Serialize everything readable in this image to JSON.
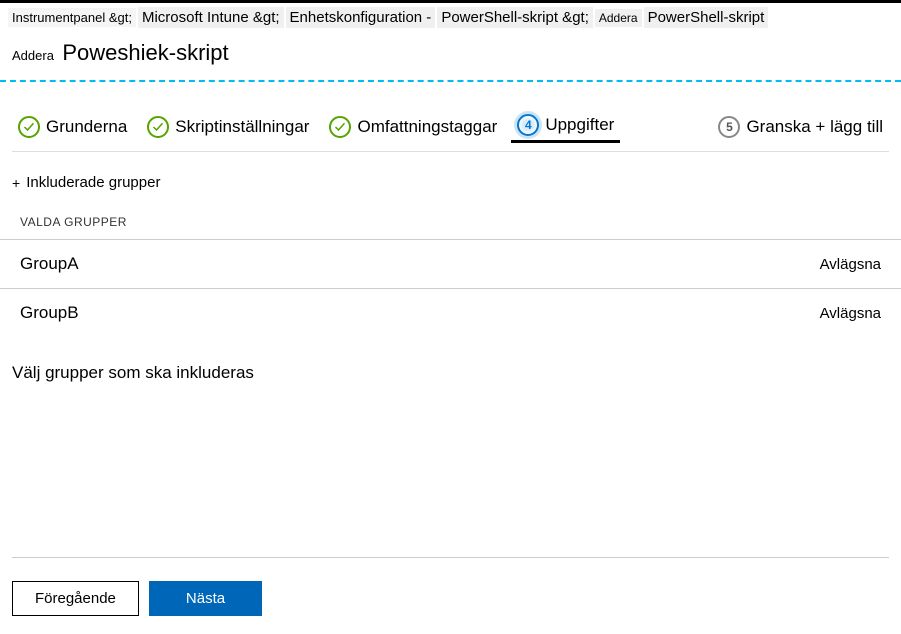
{
  "breadcrumb": {
    "item1": "Instrumentpanel &gt;",
    "item2": "Microsoft Intune &gt;",
    "item3": "Enhetskonfiguration -",
    "item4": "PowerShell-skript &gt;",
    "item5_prefix": "Addera",
    "item5_rest": "PowerShell-skript"
  },
  "header": {
    "addera": "Addera",
    "title": "Poweshiek-skript"
  },
  "steps": {
    "s1": "Grunderna",
    "s2": "Skriptinställningar",
    "s3": "Omfattningstaggar",
    "active_num": "4",
    "s4": "Uppgifter",
    "s5_num": "5",
    "s5": "Granska + lägg till"
  },
  "addGroups": {
    "plus": "+",
    "label": "Inkluderade grupper"
  },
  "sectionLabel": "VALDA GRUPPER",
  "groups": {
    "g1": "GroupA",
    "g1_remove": "Avlägsna",
    "g2": "GroupB",
    "g2_remove": "Avlägsna"
  },
  "selectGroupsLink": "Välj grupper som ska inkluderas",
  "buttons": {
    "prev": "Föregående",
    "next": "Nästa"
  }
}
